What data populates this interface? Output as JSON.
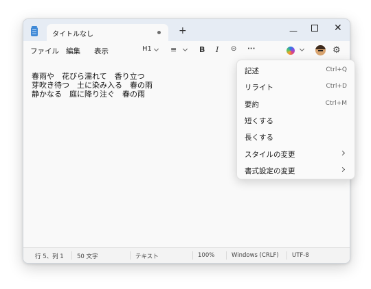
{
  "window": {
    "tab_title": "タイトルなし",
    "new_tab_label": "+",
    "minimize_label": "—",
    "close_label": "✕"
  },
  "menubar": {
    "file": "ファイル",
    "edit": "編集",
    "view": "表示"
  },
  "toolbar": {
    "heading": "H1",
    "list_icon": "≡",
    "bold": "B",
    "italic": "I",
    "link_icon": "⊝",
    "more": "···",
    "settings_icon": "⚙"
  },
  "editor": {
    "lines": [
      "春雨や　花びら濡れて　香り立つ",
      "芽吹き待つ　土に染み入る　春の雨",
      "静かなる　庭に降り注ぐ　春の雨"
    ]
  },
  "status": {
    "position": "行 5、列 1",
    "chars": "50 文字",
    "format": "テキスト",
    "zoom": "100%",
    "line_ending": "Windows (CRLF)",
    "encoding": "UTF-8"
  },
  "ai_menu": {
    "items": [
      {
        "label": "記述",
        "shortcut": "Ctrl+Q"
      },
      {
        "label": "リライト",
        "shortcut": "Ctrl+D"
      },
      {
        "label": "要約",
        "shortcut": "Ctrl+M"
      },
      {
        "label": "短くする",
        "shortcut": ""
      },
      {
        "label": "長くする",
        "shortcut": ""
      },
      {
        "label": "スタイルの変更",
        "shortcut": ""
      },
      {
        "label": "書式設定の変更",
        "shortcut": ""
      }
    ]
  },
  "colors": {
    "titlebar": "#e6ecf4",
    "accent": "#3f89d6"
  }
}
